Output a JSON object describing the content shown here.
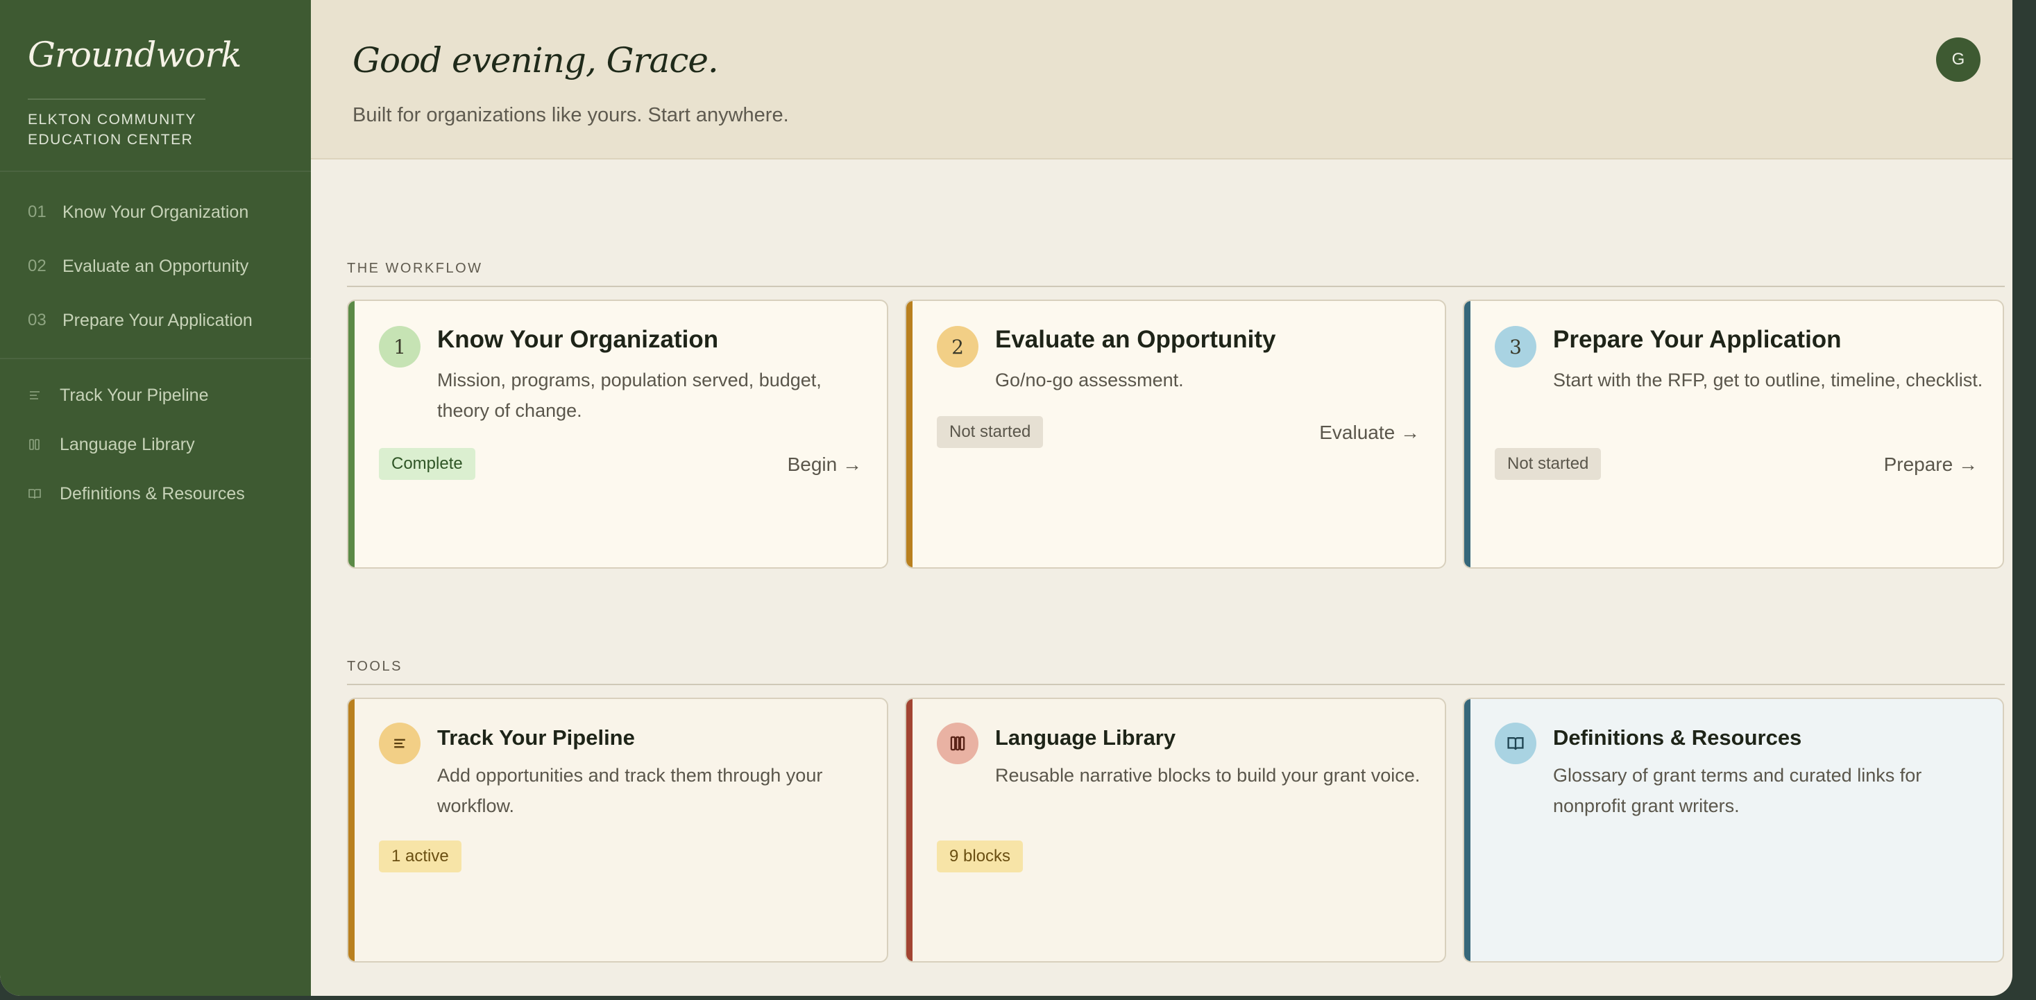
{
  "sidebar": {
    "brand": "Groundwork",
    "org_line1": "Elkton Community",
    "org_line2": "Education Center",
    "workflow_nav": [
      {
        "num": "01",
        "label": "Know Your Organization"
      },
      {
        "num": "02",
        "label": "Evaluate an Opportunity"
      },
      {
        "num": "03",
        "label": "Prepare Your Application"
      }
    ],
    "tools_nav": [
      {
        "icon": "list-icon",
        "label": "Track Your Pipeline"
      },
      {
        "icon": "columns-icon",
        "label": "Language Library"
      },
      {
        "icon": "book-icon",
        "label": "Definitions & Resources"
      }
    ]
  },
  "header": {
    "greeting": "Good evening, Grace.",
    "subtitle": "Built for organizations like yours. Start anywhere.",
    "avatar_initial": "G"
  },
  "workflow": {
    "label": "The Workflow",
    "cards": [
      {
        "num": "1",
        "title": "Know Your Organization",
        "desc": "Mission, programs, population served, budget, theory of change.",
        "status": "Complete",
        "action": "Begin →",
        "accent": "#5b8a46",
        "badge_bg": "#c6e3b4"
      },
      {
        "num": "2",
        "title": "Evaluate an Opportunity",
        "desc": "Go/no-go assessment.",
        "status": "Not started",
        "action": "Evaluate →",
        "accent": "#b9801f",
        "badge_bg": "#f2cf86"
      },
      {
        "num": "3",
        "title": "Prepare Your Application",
        "desc": "Start with the RFP, get to outline, timeline, checklist.",
        "status": "Not started",
        "action": "Prepare →",
        "accent": "#36677a",
        "badge_bg": "#a9d3e2"
      }
    ]
  },
  "tools": {
    "label": "Tools",
    "cards": [
      {
        "icon": "list-icon",
        "title": "Track Your Pipeline",
        "desc": "Add opportunities and track them through your workflow.",
        "status": "1 active",
        "accent": "#b9801f",
        "badge_bg": "#f2cf86"
      },
      {
        "icon": "columns-icon",
        "title": "Language Library",
        "desc": "Reusable narrative blocks to build your grant voice.",
        "status": "9 blocks",
        "accent": "#a24432",
        "badge_bg": "#e9b2a3"
      },
      {
        "icon": "book-icon",
        "title": "Definitions & Resources",
        "desc": "Glossary of grant terms and curated links for nonprofit grant writers.",
        "status": "",
        "accent": "#36677a",
        "badge_bg": "#a9d3e2"
      }
    ]
  }
}
